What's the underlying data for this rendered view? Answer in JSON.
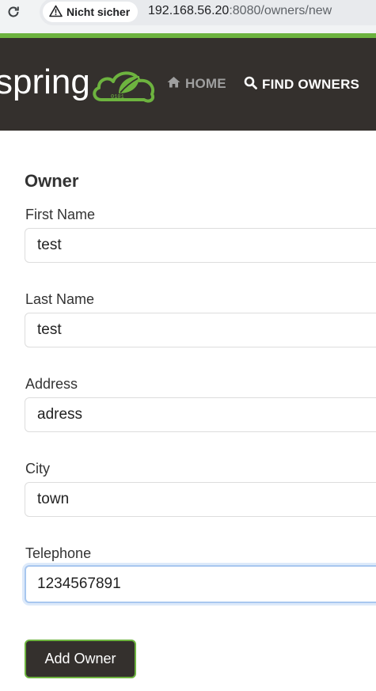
{
  "browser": {
    "security_label": "Nicht sicher",
    "url_host": "192.168.56.20",
    "url_rest": ":8080/owners/new"
  },
  "nav": {
    "logo_text": "spring",
    "home_label": "HOME",
    "find_owners_label": "FIND OWNERS"
  },
  "form": {
    "title": "Owner",
    "fields": [
      {
        "label": "First Name",
        "value": "test"
      },
      {
        "label": "Last Name",
        "value": "test"
      },
      {
        "label": "Address",
        "value": "adress"
      },
      {
        "label": "City",
        "value": "town"
      },
      {
        "label": "Telephone",
        "value": "1234567891"
      }
    ],
    "submit_label": "Add Owner"
  },
  "colors": {
    "brand_green": "#6db33f",
    "navbar_dark": "#34302d"
  }
}
